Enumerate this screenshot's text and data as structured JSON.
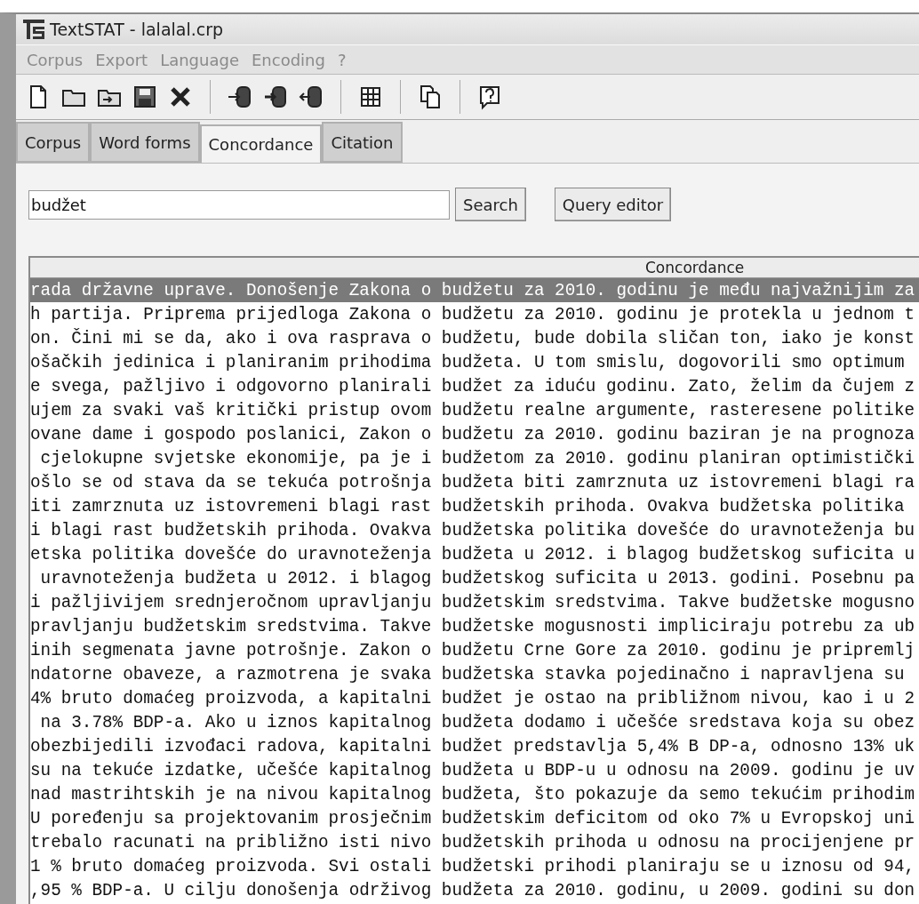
{
  "window": {
    "title": "TextSTAT - lalalal.crp"
  },
  "menu": [
    "Corpus",
    "Export",
    "Language",
    "Encoding",
    "?"
  ],
  "toolbar": [
    {
      "kind": "new"
    },
    {
      "kind": "open"
    },
    {
      "kind": "import"
    },
    {
      "kind": "save"
    },
    {
      "kind": "delete"
    },
    {
      "kind": "sep"
    },
    {
      "kind": "db-in"
    },
    {
      "kind": "db-add"
    },
    {
      "kind": "db-out"
    },
    {
      "kind": "sep"
    },
    {
      "kind": "grid"
    },
    {
      "kind": "sep"
    },
    {
      "kind": "copy"
    },
    {
      "kind": "sep"
    },
    {
      "kind": "help"
    }
  ],
  "tabs": [
    {
      "label": "Corpus",
      "selected": false
    },
    {
      "label": "Word forms",
      "selected": false
    },
    {
      "label": "Concordance",
      "selected": true
    },
    {
      "label": "Citation",
      "selected": false
    }
  ],
  "search": {
    "value": "budžet",
    "buttons": [
      "Search",
      "Query editor"
    ]
  },
  "table": {
    "column": "Concordance",
    "rows": [
      {
        "left": "rada državne uprave. Donošenje Zakona o",
        "right": "budžetu za 2010. godinu je među najvažnijim za",
        "selected": true
      },
      {
        "left": "h partija. Priprema prijedloga Zakona o",
        "right": "budžetu za 2010. godinu je protekla u jednom t",
        "selected": false
      },
      {
        "left": "on. Čini mi se da, ako i ova rasprava o",
        "right": "budžetu, bude dobila sličan ton, iako je konst",
        "selected": false
      },
      {
        "left": "ošačkih jedinica i planiranim prihodima",
        "right": "budžeta. U tom smislu, dogovorili smo optimum",
        "selected": false
      },
      {
        "left": "e svega, pažljivo i odgovorno planirali",
        "right": "budžet za iduću godinu. Zato, želim da čujem z",
        "selected": false
      },
      {
        "left": "ujem za svaki vaš kritički pristup ovom",
        "right": "budžetu realne argumente, rasteresene politike",
        "selected": false
      },
      {
        "left": "ovane dame i gospodo poslanici, Zakon o",
        "right": "budžetu za 2010. godinu baziran je na prognoza",
        "selected": false
      },
      {
        "left": "cjelokupne svjetske ekonomije, pa je i",
        "right": "budžetom za 2010. godinu planiran optimistički",
        "selected": false
      },
      {
        "left": "ošlo se od stava da se tekuća potrošnja",
        "right": "budžeta biti zamrznuta uz istovremeni blagi ra",
        "selected": false
      },
      {
        "left": "iti zamrznuta uz istovremeni blagi rast",
        "right": "budžetskih prihoda. Ovakva budžetska politika",
        "selected": false
      },
      {
        "left": "i blagi rast budžetskih prihoda. Ovakva",
        "right": "budžetska politika dovešće do uravnoteženja bu",
        "selected": false
      },
      {
        "left": "etska politika dovešće do uravnoteženja",
        "right": "budžeta u 2012. i blagog budžetskog suficita u",
        "selected": false
      },
      {
        "left": "uravnoteženja budžeta u 2012. i blagog",
        "right": "budžetskog suficita u 2013. godini. Posebnu pa",
        "selected": false
      },
      {
        "left": "i pažljivijem srednjeročnom upravljanju",
        "right": "budžetskim sredstvima. Takve budžetske mogusno",
        "selected": false
      },
      {
        "left": "pravljanju budžetskim sredstvima. Takve",
        "right": "budžetske mogusnosti impliciraju potrebu za ub",
        "selected": false
      },
      {
        "left": "inih segmenata javne potrošnje. Zakon o",
        "right": "budžetu Crne Gore za 2010. godinu je pripremlj",
        "selected": false
      },
      {
        "left": "ndatorne obaveze, a razmotrena je svaka",
        "right": "budžetska stavka pojedinačno i napravljena su",
        "selected": false
      },
      {
        "left": "4% bruto domaćeg proizvoda, a kapitalni",
        "right": "budžet je ostao na približnom nivou, kao i u 2",
        "selected": false
      },
      {
        "left": "na 3.78% BDP-a. Ako u iznos kapitalnog",
        "right": "budžeta dodamo i učešće sredstava koja su obez",
        "selected": false
      },
      {
        "left": "obezbijedili izvođaci radova, kapitalni",
        "right": "budžet predstavlja 5,4% B DP-a, odnosno 13% uk",
        "selected": false
      },
      {
        "left": "su na tekuće izdatke, učešće kapitalnog",
        "right": "budžeta u BDP-u u odnosu na 2009. godinu je uv",
        "selected": false
      },
      {
        "left": "nad mastrihtskih je na nivou kapitalnog",
        "right": "budžeta, što pokazuje da semo tekućim prihodim",
        "selected": false
      },
      {
        "left": "U poređenju sa projektovanim prosječnim",
        "right": "budžetskim deficitom od oko 7% u Evropskoj uni",
        "selected": false
      },
      {
        "left": "trebalo racunati na približno isti nivo",
        "right": "budžetskih prihoda u odnosu na procijenjene pr",
        "selected": false
      },
      {
        "left": "1 % bruto domaćeg proizvoda. Svi ostali",
        "right": "budžetski prihodi planiraju se u iznosu od 94,",
        "selected": false
      },
      {
        "left": ",95 % BDP-a. U cilju donošenja održivog",
        "right": "budžeta za 2010. godinu, u 2009. godini su don",
        "selected": false
      }
    ]
  }
}
